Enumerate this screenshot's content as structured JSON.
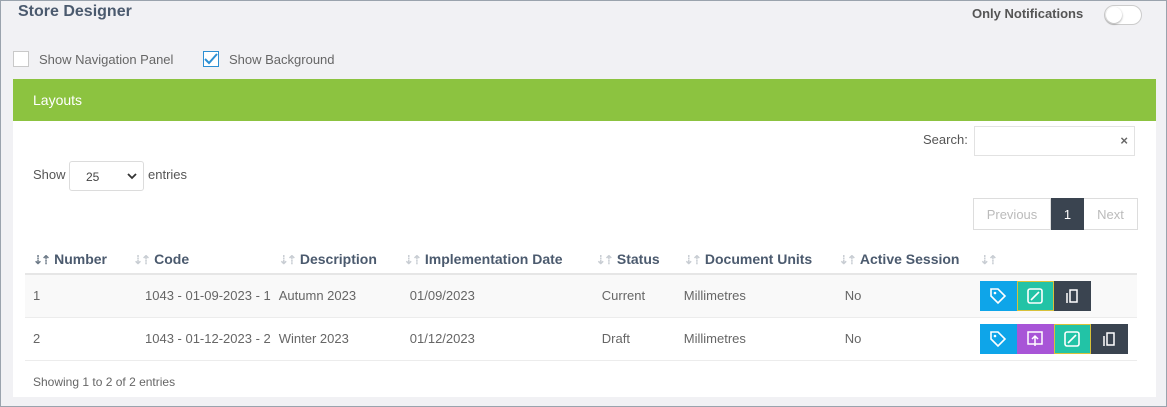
{
  "header": {
    "title": "Store Designer",
    "only_notifications_label": "Only Notifications",
    "only_notifications_on": false
  },
  "options": {
    "show_nav_panel": {
      "label": "Show Navigation Panel",
      "checked": false
    },
    "show_background": {
      "label": "Show Background",
      "checked": true
    }
  },
  "panel": {
    "title": "Layouts",
    "search_label": "Search:",
    "search_value": "",
    "search_clear": "×",
    "show_label": "Show",
    "entries_label": "entries",
    "page_length": "25",
    "pagination": {
      "previous": "Previous",
      "current": "1",
      "next": "Next"
    },
    "columns": [
      "Number",
      "Code",
      "Description",
      "Implementation Date",
      "Status",
      "Document Units",
      "Active Session",
      ""
    ],
    "rows": [
      {
        "number": "1",
        "code": "1043 - 01-09-2023 - 1",
        "description": "Autumn 2023",
        "date": "01/09/2023",
        "status": "Current",
        "units": "Millimetres",
        "active": "No",
        "actions": [
          "tag-icon",
          "edit-icon",
          "copy-icon"
        ]
      },
      {
        "number": "2",
        "code": "1043 - 01-12-2023 - 2",
        "description": "Winter 2023",
        "date": "01/12/2023",
        "status": "Draft",
        "units": "Millimetres",
        "active": "No",
        "actions": [
          "tag-icon",
          "upload-icon",
          "edit-icon",
          "copy-icon"
        ]
      }
    ],
    "info": "Showing 1 to 2 of 2 entries"
  },
  "colors": {
    "header_green": "#8cc340",
    "tag_blue": "#0ea5e9",
    "edit_teal": "#22c3a6",
    "upload_purple": "#a855d7",
    "copy_dark": "#3a4450"
  }
}
